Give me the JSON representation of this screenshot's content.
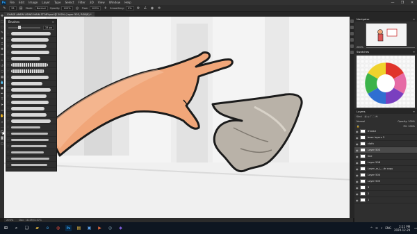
{
  "app": {
    "logo": "Ps",
    "menu": [
      "File",
      "Edit",
      "Image",
      "Layer",
      "Type",
      "Select",
      "Filter",
      "3D",
      "View",
      "Window",
      "Help"
    ],
    "window_controls": [
      "—",
      "❐",
      "✕"
    ]
  },
  "options_bar": {
    "brush_size": "33",
    "mode_label": "Mode:",
    "mode_value": "Normal",
    "opacity_label": "Opacity:",
    "opacity_value": "100%",
    "flow_label": "Flow:",
    "flow_value": "100%",
    "smoothing_label": "Smoothing:",
    "smoothing_value": "0%"
  },
  "document": {
    "tab_title": "CHASE ANEW USING MAIN STORY.psd @ 200% (Layer 503, RGB/8) *"
  },
  "toolbar_icons": [
    "move-icon",
    "marquee-icon",
    "lasso-icon",
    "quick-select-icon",
    "crop-icon",
    "eyedropper-icon",
    "healing-icon",
    "brush-icon",
    "stamp-icon",
    "history-brush-icon",
    "eraser-icon",
    "gradient-icon",
    "blur-icon",
    "dodge-icon",
    "pen-icon",
    "type-icon",
    "path-select-icon",
    "shape-icon",
    "hand-icon",
    "zoom-icon",
    "more-icon",
    "colors-icon",
    "quickmask-icon",
    "screenmode-icon"
  ],
  "brushes_panel": {
    "title": "Brushes",
    "size_value": "33 px",
    "strokes": 22
  },
  "status_bar": {
    "zoom": "200%",
    "doc_info": "Doc: 18.4M/3.47G"
  },
  "right_panels": {
    "navigator_title": "Navigator",
    "navigator_zoom": "200%",
    "swatches_title": "Swatches",
    "layers_title": "Layers",
    "layers_kind": "Kind",
    "layers_blend": "Normal",
    "layers_opacity": "Opacity: 100%",
    "layers_fill": "Fill: 100%",
    "layers": [
      {
        "name": "thread",
        "selected": false
      },
      {
        "name": "base layers 3",
        "selected": false
      },
      {
        "name": "cloth",
        "selected": false
      },
      {
        "name": "Layer 503",
        "selected": true
      },
      {
        "name": "line",
        "selected": false
      },
      {
        "name": "Layer 508",
        "selected": false
      },
      {
        "name": "Layer_w_i_...dr copy",
        "selected": false
      },
      {
        "name": "Layer 504",
        "selected": false
      },
      {
        "name": "Layer 505",
        "selected": false
      },
      {
        "name": "3",
        "selected": false
      },
      {
        "name": "2",
        "selected": false
      },
      {
        "name": "1",
        "selected": false
      }
    ]
  },
  "taskbar": {
    "start_icon": "windows-icon",
    "apps": [
      "search-icon",
      "task-view-icon",
      "file-explorer-icon",
      "edge-icon",
      "chrome-icon",
      "photoshop-icon",
      "folder-icon",
      "store-icon",
      "media-icon",
      "steam-icon",
      "app-icon"
    ],
    "language": "ENG",
    "time": "2:11 PM",
    "date": "2020-12-29"
  },
  "colors": {
    "accent": "#31a8ff",
    "skin": "#f1a679",
    "cloth": "#b9b2a8",
    "panel": "#2f2f2f"
  }
}
